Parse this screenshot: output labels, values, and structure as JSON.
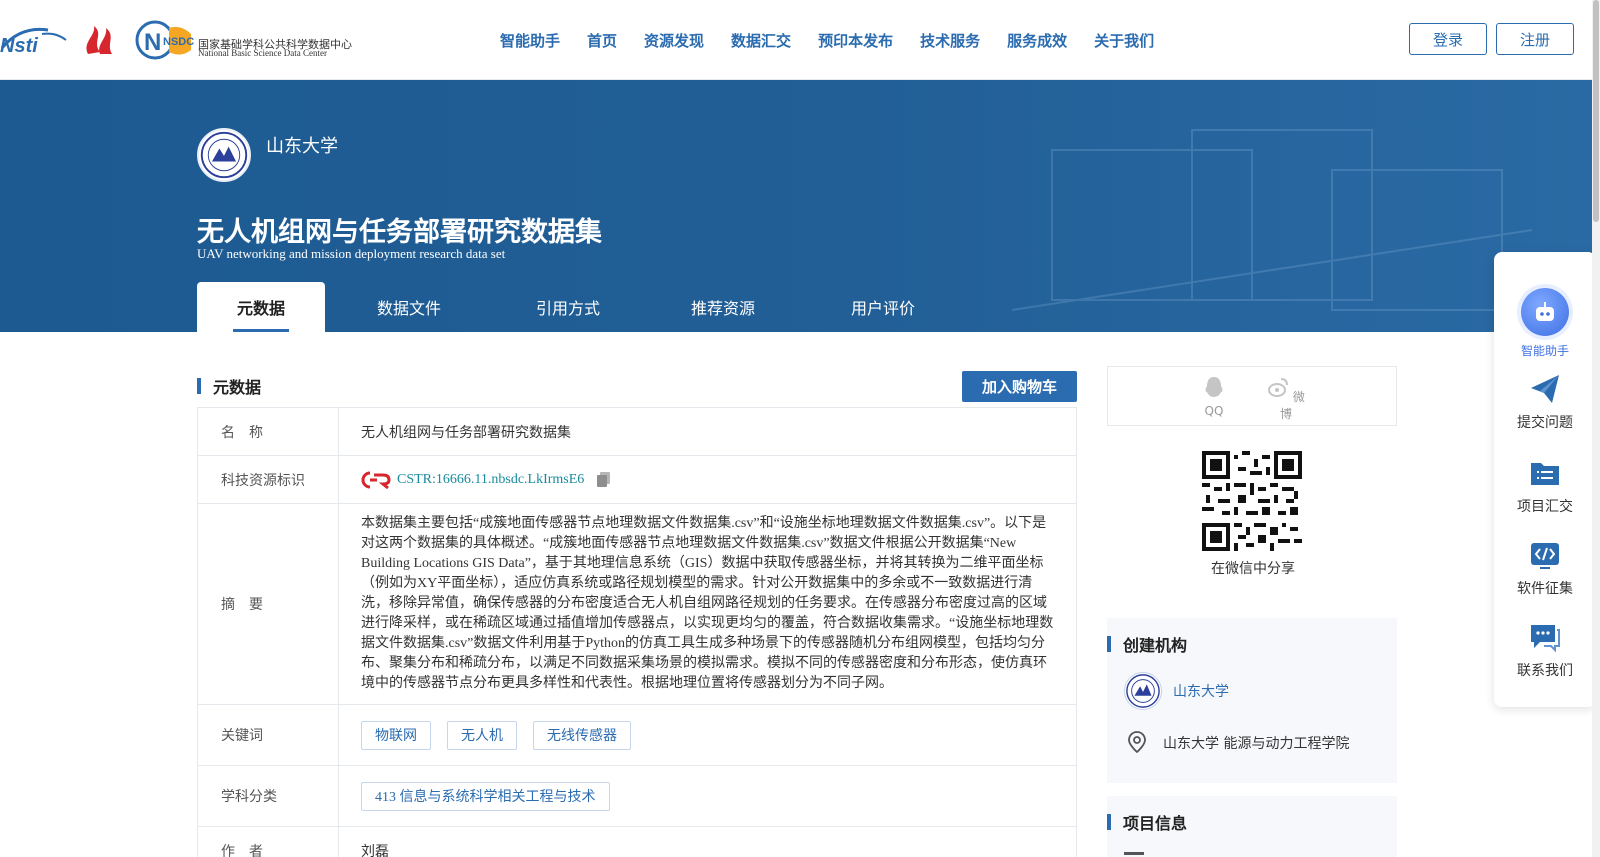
{
  "header": {
    "logo_nsdc_badge": "NSDC",
    "logo_nsdc_cn": "国家基础学科公共科学数据中心",
    "logo_nsdc_en": "National Basic Science Data Center",
    "nav": [
      "智能助手",
      "首页",
      "资源发现",
      "数据汇交",
      "预印本发布",
      "技术服务",
      "服务成效",
      "关于我们"
    ],
    "login": "登录",
    "register": "注册"
  },
  "banner": {
    "org_name": "山东大学",
    "title_cn": "无人机组网与任务部署研究数据集",
    "title_en": "UAV networking and mission deployment research data set",
    "tabs": [
      "元数据",
      "数据文件",
      "引用方式",
      "推荐资源",
      "用户评价"
    ],
    "active_tab": 0
  },
  "metadata": {
    "section_title": "元数据",
    "cart_button": "加入购物车",
    "rows": {
      "name_label": "名　称",
      "name_value": "无人机组网与任务部署研究数据集",
      "id_label": "科技资源标识",
      "id_value": "CSTR:16666.11.nbsdc.LkIrmsE6",
      "abstract_label": "摘　要",
      "abstract_value": "本数据集主要包括“成簇地面传感器节点地理数据文件数据集.csv”和“设施坐标地理数据文件数据集.csv”。以下是对这两个数据集的具体概述。“成簇地面传感器节点地理数据文件数据集.csv”数据文件根据公开数据集“New Building Locations GIS Data”，基于其地理信息系统（GIS）数据中获取传感器坐标，并将其转换为二维平面坐标（例如为XY平面坐标），适应仿真系统或路径规划模型的需求。针对公开数据集中的多余或不一致数据进行清洗，移除异常值，确保传感器的分布密度适合无人机自组网路径规划的任务要求。在传感器分布密度过高的区域进行降采样，或在稀疏区域通过插值增加传感器点，以实现更均匀的覆盖，符合数据收集需求。“设施坐标地理数据文件数据集.csv”数据文件利用基于Python的仿真工具生成多种场景下的传感器随机分布组网模型，包括均匀分布、聚集分布和稀疏分布，以满足不同数据采集场景的模拟需求。模拟不同的传感器密度和分布形态，使仿真环境中的传感器节点分布更具多样性和代表性。根据地理位置将传感器划分为不同子网。",
      "keywords_label": "关键词",
      "keywords": [
        "物联网",
        "无人机",
        "无线传感器"
      ],
      "subject_label": "学科分类",
      "subject_value": "413 信息与系统科学相关工程与技术",
      "author_label": "作　者",
      "author_value": "刘磊"
    }
  },
  "share": {
    "qq": "QQ",
    "weibo": "微博",
    "wechat_caption": "在微信中分享"
  },
  "org_card": {
    "title": "创建机构",
    "org_link": "山东大学",
    "department": "山东大学 能源与动力工程学院"
  },
  "project_card": {
    "title": "项目信息"
  },
  "float_bar": {
    "assistant": "智能助手",
    "submit": "提交问题",
    "projects": "项目汇交",
    "software": "软件征集",
    "contact": "联系我们"
  },
  "colors": {
    "primary": "#2b6cb0",
    "banner": "#1d5a92",
    "link_teal": "#1a8a9c",
    "cstr_red": "#d7262e"
  }
}
